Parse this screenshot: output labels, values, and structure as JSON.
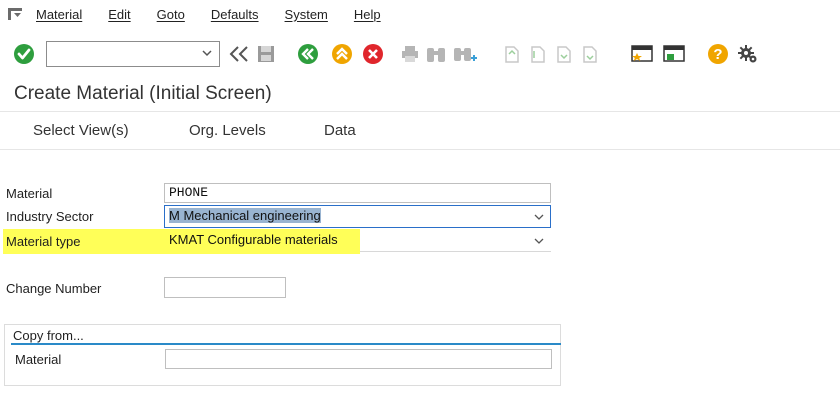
{
  "menu": {
    "items": [
      "Material",
      "Edit",
      "Goto",
      "Defaults",
      "System",
      "Help"
    ]
  },
  "toolbar": {
    "command_value": "",
    "icons": [
      "ok-check-icon",
      "command-dropdown-icon",
      "double-chevron-left-icon",
      "save-icon",
      "back-icon",
      "exit-icon",
      "cancel-icon",
      "print-icon",
      "find-icon",
      "find-next-icon",
      "first-page-icon",
      "previous-page-icon",
      "next-page-icon",
      "last-page-icon",
      "create-session-icon",
      "shortcut-icon",
      "help-icon",
      "settings-icon"
    ],
    "colors": {
      "ok": "#2e9e3e",
      "back": "#2e9e3e",
      "exit": "#f0a500",
      "cancel": "#e0262c",
      "help": "#f0a500"
    }
  },
  "title": "Create Material (Initial Screen)",
  "app_toolbar": {
    "buttons": [
      "Select View(s)",
      "Org. Levels",
      "Data"
    ]
  },
  "form": {
    "material_label": "Material",
    "material_value": "PHONE",
    "industry_label": "Industry Sector",
    "industry_value": "M Mechanical engineering",
    "type_label": "Material type",
    "type_value": "KMAT Configurable materials",
    "change_label": "Change Number",
    "change_value": ""
  },
  "copy_from": {
    "title": "Copy from...",
    "material_label": "Material",
    "material_value": ""
  },
  "highlight_color": "#ffff3b"
}
